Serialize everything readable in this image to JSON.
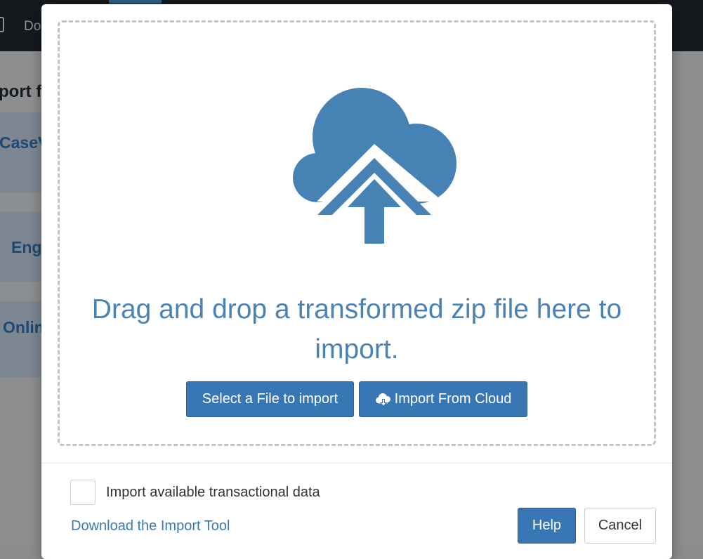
{
  "background": {
    "topbar": {
      "tab_label": "Do"
    },
    "heading": "port f",
    "cards": [
      {
        "label": "CaseV"
      },
      {
        "label": "Eng"
      },
      {
        "label": "Onlin"
      }
    ]
  },
  "modal": {
    "dropzone": {
      "illustration": "cloud-upload-icon",
      "message": "Drag and drop a transformed zip file here to import.",
      "select_button_label": "Select a File to import",
      "cloud_button_label": "Import From Cloud",
      "cloud_button_icon": "cloud-download-icon"
    },
    "footer": {
      "checkbox_label": "Import available transactional data",
      "checkbox_checked": false,
      "download_link": "Download the Import Tool",
      "help_label": "Help",
      "cancel_label": "Cancel"
    }
  },
  "colors": {
    "accent": "#3876b4",
    "illustration": "#4682b4",
    "message_text": "#4b82b4",
    "link": "#3a78b5"
  }
}
